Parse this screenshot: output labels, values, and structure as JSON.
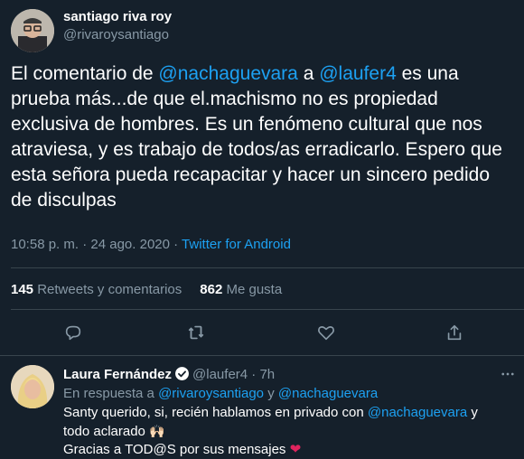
{
  "tweet": {
    "author_name": "santiago riva roy",
    "author_handle": "@rivaroysantiago",
    "text_1": "El comentario de ",
    "mention_1": "@nachaguevara",
    "text_2": " a ",
    "mention_2": "@laufer4",
    "text_3": " es una prueba más...de que el.machismo no es propiedad exclusiva de hombres.  Es un fenómeno cultural que nos atraviesa, y es trabajo de todos/as erradicarlo. Espero que esta señora pueda recapacitar y hacer un sincero pedido de disculpas",
    "time": "10:58 p. m.",
    "sep": " · ",
    "date": "24 ago. 2020",
    "source": "Twitter for Android"
  },
  "stats": {
    "retweets_count": "145",
    "retweets_label": "Retweets y comentarios",
    "likes_count": "862",
    "likes_label": "Me gusta"
  },
  "actions": {
    "icons": [
      "reply-icon",
      "retweet-icon",
      "like-icon",
      "share-icon"
    ]
  },
  "reply": {
    "author_name": "Laura Fernández",
    "author_handle": "@laufer4",
    "sep": " · ",
    "time": "7h",
    "verified": true,
    "reply_prefix": "En respuesta a ",
    "reply_user_1": "@rivaroysantiago",
    "reply_and": " y ",
    "reply_user_2": "@nachaguevara",
    "line1_text": "Santy querido, si, recién hablamos en privado con ",
    "line1_mention": "@nachaguevara",
    "line1_tail": " y todo aclarado ",
    "emoji_hands": "🙌🏻",
    "line2_text": "Gracias a TOD@S por sus mensajes ",
    "emoji_heart": "❤"
  },
  "colors": {
    "background": "#15202b",
    "link": "#1da1f2",
    "muted": "#8899a6",
    "divider": "#38444d",
    "heart": "#e0245e"
  }
}
